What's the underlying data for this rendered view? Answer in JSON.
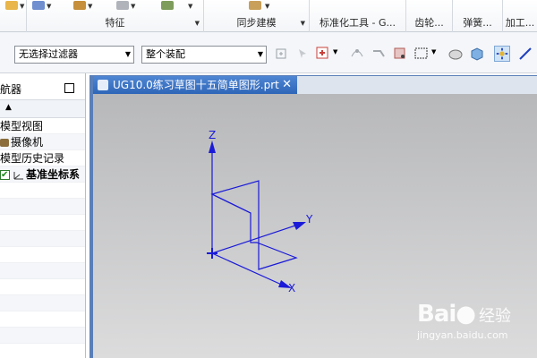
{
  "ribbon": {
    "groups": [
      {
        "label": ""
      },
      {
        "label": "特征"
      },
      {
        "label": "同步建模"
      },
      {
        "label": "标准化工具 - G..."
      },
      {
        "label": "齿轮..."
      },
      {
        "label": "弹簧..."
      },
      {
        "label": "加工..."
      }
    ]
  },
  "toolbar": {
    "filter": {
      "value": "无选择过滤器"
    },
    "scope": {
      "value": "整个装配"
    }
  },
  "navigator": {
    "title": "航器",
    "items": [
      {
        "label": "模型视图"
      },
      {
        "label": "摄像机"
      },
      {
        "label": "模型历史记录"
      },
      {
        "label": "基准坐标系"
      }
    ]
  },
  "tab": {
    "title": "UG10.0练习草图十五简单图形.prt",
    "close": "✕"
  },
  "axes": {
    "x": "X",
    "y": "Y",
    "z": "Z"
  },
  "colors": {
    "axis": "#1a1ad8",
    "tab": "#3a74c6",
    "viewport_top": "#b7b8ba",
    "viewport_bottom": "#dcdcdd"
  },
  "watermark": {
    "brand": "Bai",
    "brand2": "经验",
    "url": "jingyan.baidu.com"
  }
}
